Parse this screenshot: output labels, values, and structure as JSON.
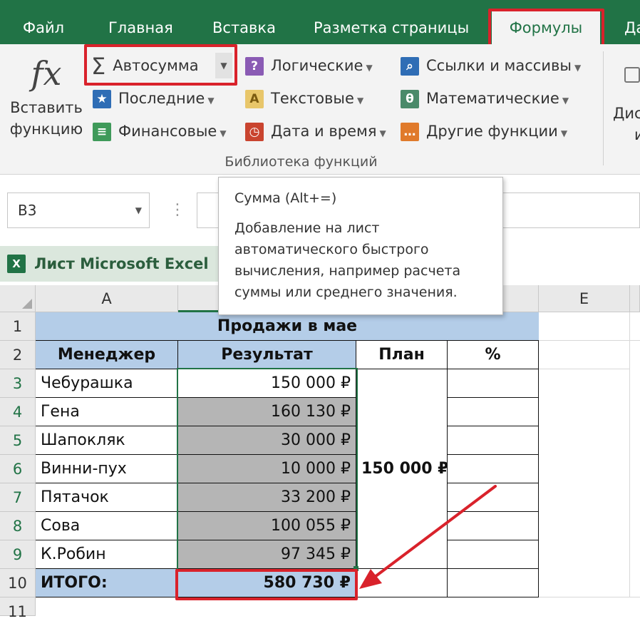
{
  "tabs": {
    "file": "Файл",
    "home": "Главная",
    "insert": "Вставка",
    "page_layout": "Разметка страницы",
    "formulas": "Формулы",
    "next_cut": "Да"
  },
  "ribbon": {
    "insert_function_line1": "Вставить",
    "insert_function_line2": "функцию",
    "fx_glyph": "fx",
    "autosum": "Автосумма",
    "recent": "Последние",
    "financial": "Финансовые",
    "logical": "Логические",
    "text": "Текстовые",
    "datetime": "Дата и время",
    "lookup": "Ссылки и массивы",
    "math": "Математические",
    "more": "Другие функции",
    "group_label": "Библиотека функций",
    "right_cut_line1": "Дис",
    "right_cut_line2": "и"
  },
  "namebox": {
    "value": "B3"
  },
  "sheet_tab": {
    "label": "Лист Microsoft Excel"
  },
  "tooltip": {
    "title": "Сумма (Alt+=)",
    "line1": "Добавление на лист",
    "line2": "автоматического быстрого",
    "line3": "вычисления, например расчета",
    "line4": "суммы или среднего значения."
  },
  "columns": [
    "A",
    "E"
  ],
  "rows": [
    "1",
    "2",
    "3",
    "4",
    "5",
    "6",
    "7",
    "8",
    "9",
    "10",
    "11"
  ],
  "table": {
    "title": "Продажи в мае",
    "headers": {
      "manager": "Менеджер",
      "result": "Результат",
      "plan": "План",
      "percent": "%"
    },
    "managers": [
      "Чебурашка",
      "Гена",
      "Шапокляк",
      "Винни-пух",
      "Пятачок",
      "Сова",
      "К.Робин"
    ],
    "results": [
      "150 000 ₽",
      "160 130 ₽",
      "30 000 ₽",
      "10 000 ₽",
      "33 200 ₽",
      "100 055 ₽",
      "97 345 ₽"
    ],
    "plan_value": "150 000 ₽",
    "total_label": "ИТОГО:",
    "total_value": "580 730 ₽"
  },
  "colors": {
    "excel_green": "#217346",
    "highlight_red": "#d9222b",
    "header_blue": "#b4cde8"
  }
}
